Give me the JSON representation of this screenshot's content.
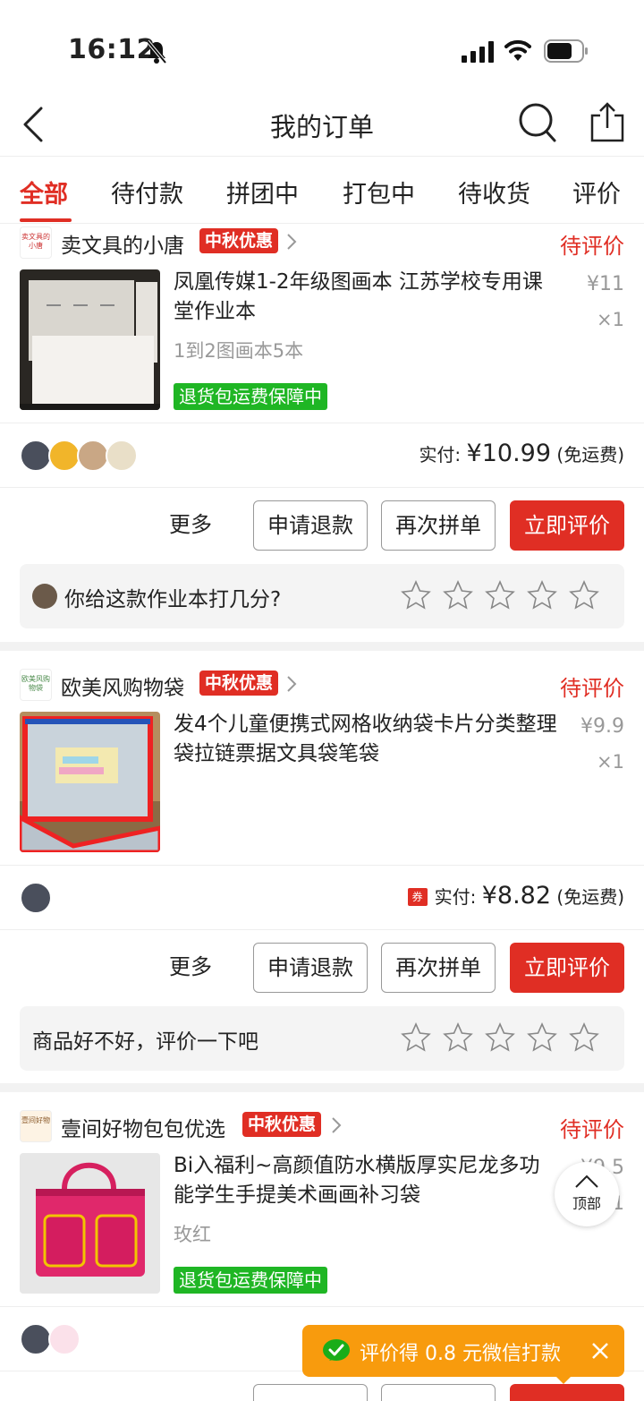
{
  "status_bar": {
    "time": "16:12"
  },
  "nav": {
    "title": "我的订单"
  },
  "tabs": [
    {
      "label": "全部",
      "active": true
    },
    {
      "label": "待付款"
    },
    {
      "label": "拼团中"
    },
    {
      "label": "打包中"
    },
    {
      "label": "待收货"
    },
    {
      "label": "评价"
    }
  ],
  "orders": [
    {
      "shop_logo_text": "卖文具的小唐",
      "shop_name": "卖文具的小唐",
      "promo": "中秋优惠",
      "status": "待评价",
      "product_title": "凤凰传媒1-2年级图画本 江苏学校专用课堂作业本",
      "product_spec": "1到2图画本5本",
      "guarantee": "退货包运费保障中",
      "price": "¥11",
      "qty": "×1",
      "paid_label": "实付:",
      "paid_amount": "¥10.99",
      "shipping": "(免运费)",
      "buttons": {
        "more": "更多",
        "refund": "申请退款",
        "regroup": "再次拼单",
        "review": "立即评价"
      },
      "rate_prompt": "你给这款作业本打几分?"
    },
    {
      "shop_logo_text": "欧美风购物袋",
      "shop_name": "欧美风购物袋",
      "promo": "中秋优惠",
      "status": "待评价",
      "product_title": "发4个儿童便携式网格收纳袋卡片分类整理袋拉链票据文具袋笔袋",
      "price": "¥9.9",
      "qty": "×1",
      "coupon_icon": "券",
      "paid_label": "实付:",
      "paid_amount": "¥8.82",
      "shipping": "(免运费)",
      "buttons": {
        "more": "更多",
        "refund": "申请退款",
        "regroup": "再次拼单",
        "review": "立即评价"
      },
      "rate_prompt": "商品好不好，评价一下吧"
    },
    {
      "shop_logo_text": "壹间好物",
      "shop_name": "壹间好物包包优选",
      "promo": "中秋优惠",
      "status": "待评价",
      "product_title": "Bi入福利~高颜值防水横版厚实尼龙多功能学生手提美术画画补习袋",
      "product_spec": "玫红",
      "guarantee": "退货包运费保障中",
      "price": "¥9.5",
      "qty": "×1"
    }
  ],
  "floating": {
    "top_button": "顶部",
    "toast": "评价得 0.8 元微信打款"
  },
  "colors": {
    "accent": "#e02e24",
    "guarantee_green": "#1fb624",
    "toast_orange": "#f89b0d"
  }
}
